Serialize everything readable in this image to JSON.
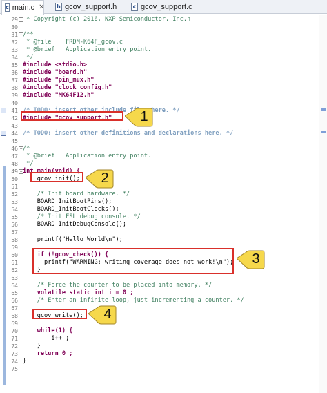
{
  "tabs": [
    {
      "label": "main.c",
      "icon": "c-file-icon",
      "active": true
    },
    {
      "label": "gcov_support.h",
      "icon": "h-file-icon",
      "active": false
    },
    {
      "label": "gcov_support.c",
      "icon": "c-file-icon",
      "active": false
    }
  ],
  "close_glyph": "✕",
  "editor": {
    "lines": [
      {
        "num": "29",
        "text": " * Copyright (c) 2016, NXP Semiconductor, Inc.▯",
        "style": "com"
      },
      {
        "num": "30",
        "text": " ",
        "style": "plain"
      },
      {
        "num": "31",
        "text": "/**",
        "style": "com"
      },
      {
        "num": "32",
        "text": " * @file    FRDM-K64F_gcov.c",
        "style": "com"
      },
      {
        "num": "33",
        "text": " * @brief   Application entry point.",
        "style": "com"
      },
      {
        "num": "34",
        "text": " */",
        "style": "com"
      },
      {
        "num": "35",
        "text": "#include <stdio.h>",
        "style": "pre"
      },
      {
        "num": "36",
        "text": "#include \"board.h\"",
        "style": "pre"
      },
      {
        "num": "37",
        "text": "#include \"pin_mux.h\"",
        "style": "pre"
      },
      {
        "num": "38",
        "text": "#include \"clock_config.h\"",
        "style": "pre"
      },
      {
        "num": "39",
        "text": "#include \"MK64F12.h\"",
        "style": "pre"
      },
      {
        "num": "40",
        "text": " ",
        "style": "plain"
      },
      {
        "num": "41",
        "text": "/* TODO: insert other include files here. */",
        "style": "task"
      },
      {
        "num": "42",
        "text": "#include \"gcov_support.h\"",
        "style": "pre"
      },
      {
        "num": "43",
        "text": " ",
        "style": "plain"
      },
      {
        "num": "44",
        "text": "/* TODO: insert other definitions and declarations here. */",
        "style": "task"
      },
      {
        "num": "45",
        "text": " ",
        "style": "plain"
      },
      {
        "num": "46",
        "text": "/*",
        "style": "com"
      },
      {
        "num": "47",
        "text": " * @brief   Application entry point.",
        "style": "com"
      },
      {
        "num": "48",
        "text": " */",
        "style": "com"
      },
      {
        "num": "49",
        "text": "int main(void) {",
        "style": "kw"
      },
      {
        "num": "50",
        "text": "    gcov_init();",
        "style": "plain"
      },
      {
        "num": "51",
        "text": " ",
        "style": "plain"
      },
      {
        "num": "52",
        "text": "    /* Init board hardware. */",
        "style": "com"
      },
      {
        "num": "53",
        "text": "    BOARD_InitBootPins();",
        "style": "plain"
      },
      {
        "num": "54",
        "text": "    BOARD_InitBootClocks();",
        "style": "plain"
      },
      {
        "num": "55",
        "text": "    /* Init FSL debug console. */",
        "style": "com"
      },
      {
        "num": "56",
        "text": "    BOARD_InitDebugConsole();",
        "style": "plain"
      },
      {
        "num": "57",
        "text": " ",
        "style": "plain"
      },
      {
        "num": "58",
        "text": "    printf(\"Hello World\\n\");",
        "style": "plain"
      },
      {
        "num": "59",
        "text": " ",
        "style": "plain"
      },
      {
        "num": "60",
        "text": "    if (!gcov_check()) {",
        "style": "kw"
      },
      {
        "num": "61",
        "text": "      printf(\"WARNING: writing coverage does not work!\\n\");",
        "style": "plain"
      },
      {
        "num": "62",
        "text": "    }",
        "style": "plain"
      },
      {
        "num": "63",
        "text": " ",
        "style": "plain"
      },
      {
        "num": "64",
        "text": "    /* Force the counter to be placed into memory. */",
        "style": "com"
      },
      {
        "num": "65",
        "text": "    volatile static int i = 0 ;",
        "style": "kw"
      },
      {
        "num": "66",
        "text": "    /* Enter an infinite loop, just incrementing a counter. */",
        "style": "com"
      },
      {
        "num": "67",
        "text": " ",
        "style": "plain"
      },
      {
        "num": "68",
        "text": "    gcov_write();",
        "style": "plain"
      },
      {
        "num": "69",
        "text": " ",
        "style": "plain"
      },
      {
        "num": "70",
        "text": "    while(1) {",
        "style": "kw"
      },
      {
        "num": "71",
        "text": "        i++ ;",
        "style": "plain"
      },
      {
        "num": "72",
        "text": "    }",
        "style": "plain"
      },
      {
        "num": "73",
        "text": "    return 0 ;",
        "style": "kw"
      },
      {
        "num": "74",
        "text": "}",
        "style": "plain"
      },
      {
        "num": "75",
        "text": " ",
        "style": "plain"
      }
    ]
  },
  "callouts": [
    "1",
    "2",
    "3",
    "4"
  ],
  "colors": {
    "highlight_box": "#d9302b",
    "callout_fill": "#f6d84b",
    "comment": "#3f7f5f",
    "keyword": "#7f0055",
    "string": "#2a00ff"
  }
}
